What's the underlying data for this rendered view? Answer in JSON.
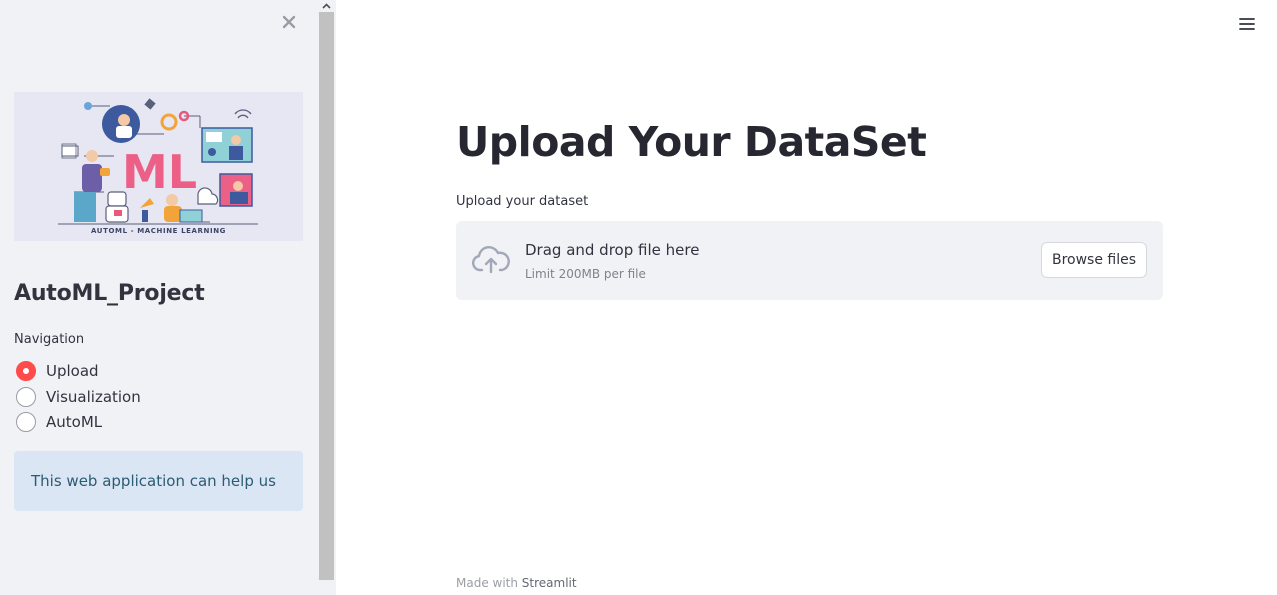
{
  "sidebar": {
    "close_icon": "close-icon",
    "hero_image": {
      "icon": "automl-illustration",
      "main_text": "ML",
      "caption": "AUTOML - MACHINE LEARNING"
    },
    "project_title": "AutoML_Project",
    "navigation_label": "Navigation",
    "nav_items": [
      {
        "label": "Upload",
        "selected": true
      },
      {
        "label": "Visualization",
        "selected": false
      },
      {
        "label": "AutoML",
        "selected": false
      }
    ],
    "info_text": "This web application can help us"
  },
  "main": {
    "menu_icon": "hamburger-menu-icon",
    "title": "Upload Your DataSet",
    "uploader": {
      "label": "Upload your dataset",
      "drop_text": "Drag and drop file here",
      "limit_text": "Limit 200MB per file",
      "browse_label": "Browse files",
      "icon": "cloud-upload-icon"
    },
    "footer": {
      "prefix": "Made with ",
      "brand": "Streamlit"
    }
  },
  "colors": {
    "sidebar_bg": "#f0f2f6",
    "accent": "#ff4b4b",
    "info_bg": "#dbe6f4",
    "info_text": "#2c5b74"
  }
}
